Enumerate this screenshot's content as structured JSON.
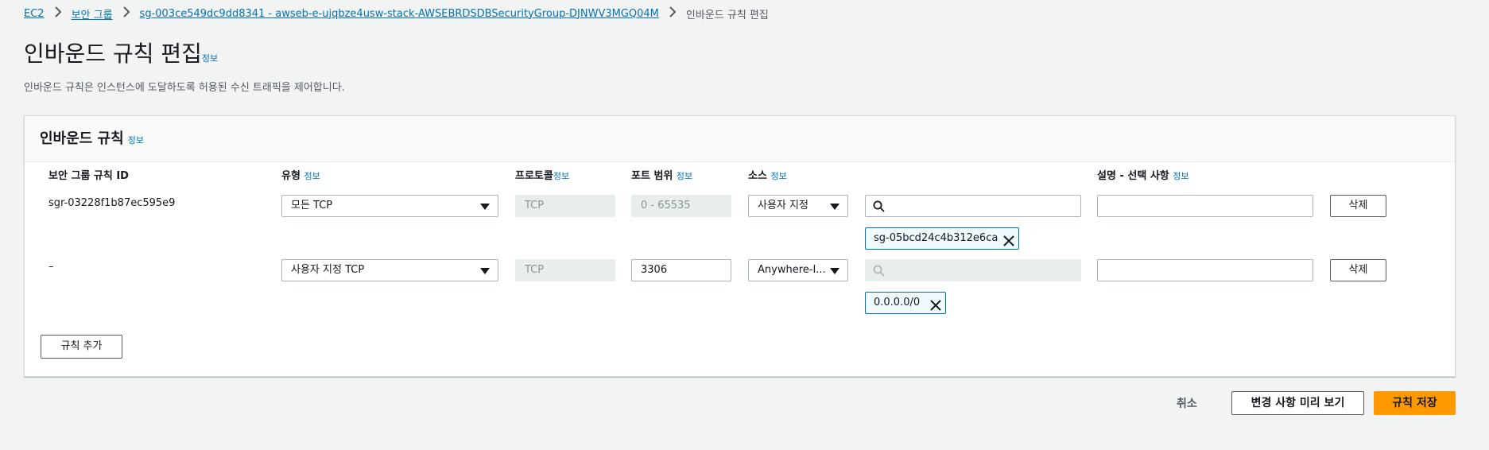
{
  "breadcrumb": {
    "items": [
      "EC2",
      "보안 그룹",
      "sg-003ce549dc9dd8341 - awseb-e-ujqbze4usw-stack-AWSEBRDSDBSecurityGroup-DJNWV3MGQ04M"
    ],
    "current": "인바운드 규칙 편집"
  },
  "header": {
    "title": "인바운드 규칙 편집",
    "info": "정보",
    "description": "인바운드 규칙은 인스턴스에 도달하도록 허용된 수신 트래픽을 제어합니다."
  },
  "panel": {
    "title": "인바운드 규칙",
    "info": "정보",
    "columns": {
      "rule_id": "보안 그룹 규칙 ID",
      "type": "유형",
      "protocol": "프로토콜",
      "port_range": "포트 범위",
      "source": "소스",
      "description": "설명 - 선택 사항",
      "info": "정보"
    },
    "rows": [
      {
        "rule_id": "sgr-03228f1b87ec595e9",
        "type": "모든 TCP",
        "protocol": "TCP",
        "port_range": "0 - 65535",
        "source_type": "사용자 지정",
        "source_search": "",
        "token": "sg-05bcd24c4b312e6ca",
        "description": "",
        "delete_label": "삭제"
      },
      {
        "rule_id": "–",
        "type": "사용자 지정 TCP",
        "protocol": "TCP",
        "port_range": "3306",
        "source_type": "Anywhere-I...",
        "source_search": "",
        "token": "0.0.0.0/0",
        "description": "",
        "delete_label": "삭제"
      }
    ],
    "add_rule_label": "규칙 추가"
  },
  "footer": {
    "cancel_label": "취소",
    "preview_label": "변경 사항 미리 보기",
    "save_label": "규칙 저장"
  },
  "colors": {
    "primary": "#ff9900",
    "link": "#0073bb",
    "token_border": "#0073bb"
  },
  "icons": [
    "chevron-right-icon",
    "caret-down-icon",
    "search-icon",
    "close-icon"
  ]
}
